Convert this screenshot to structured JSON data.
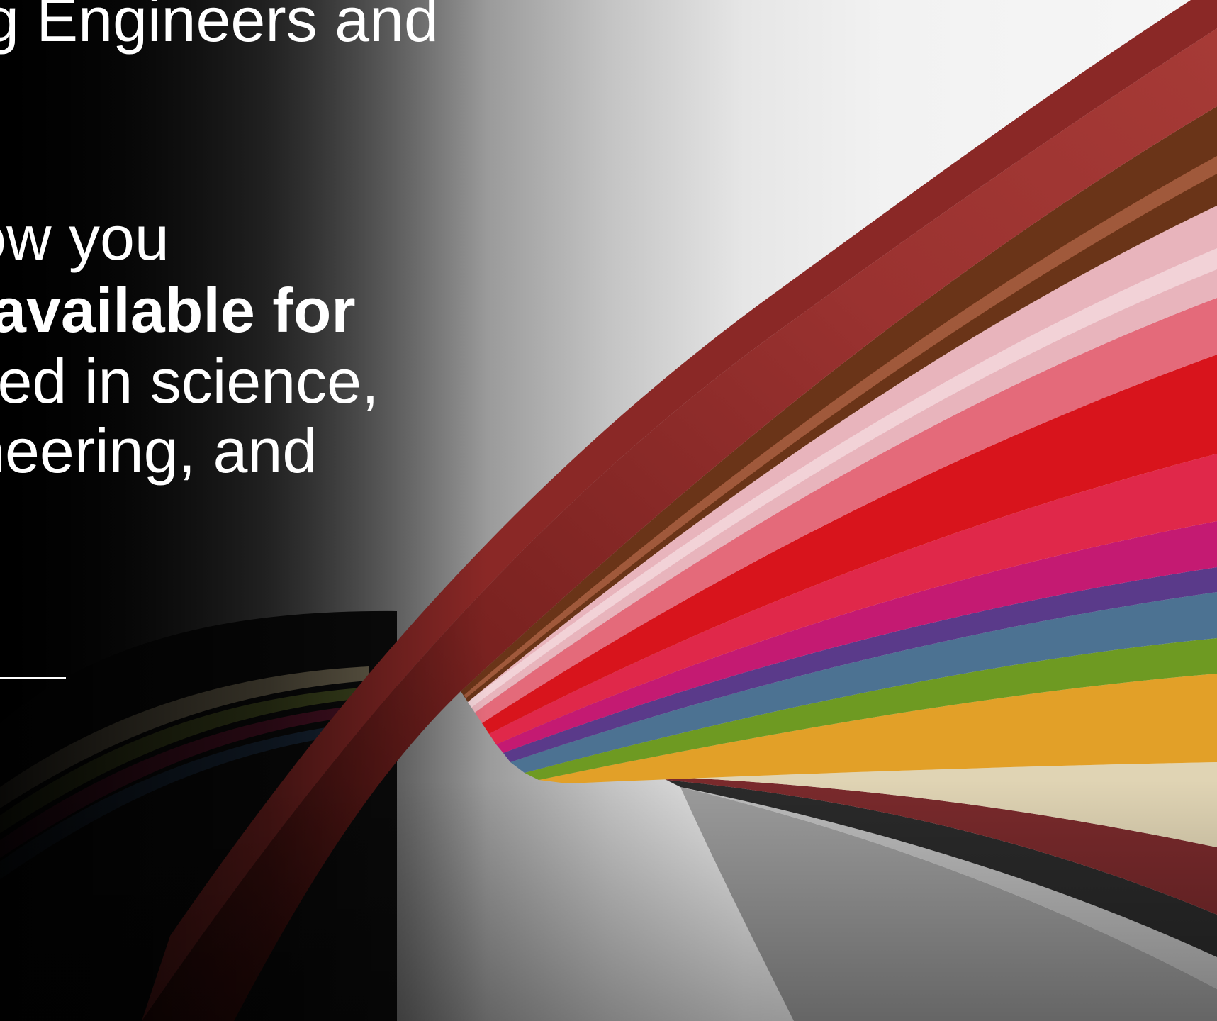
{
  "slide": {
    "lines": [
      "g Engineers and",
      "ow you",
      "ted in science,",
      "neering, and"
    ],
    "bold_phrase": "available for"
  },
  "colors": {
    "text": "#ffffff",
    "ribbon_main": "#8b2a28",
    "ribbon_brown": "#6a3418",
    "ribbon_pink": "#e8a8b0",
    "ribbon_red": "#d8141c",
    "ribbon_magenta": "#c0186e",
    "ribbon_blue": "#4a7090",
    "ribbon_green": "#6a9a20",
    "ribbon_yellow": "#e0a020",
    "ribbon_cream": "#e8dcc0",
    "ribbon_dark": "#2a2a2a",
    "ribbon_grey": "#9a9a9a"
  }
}
